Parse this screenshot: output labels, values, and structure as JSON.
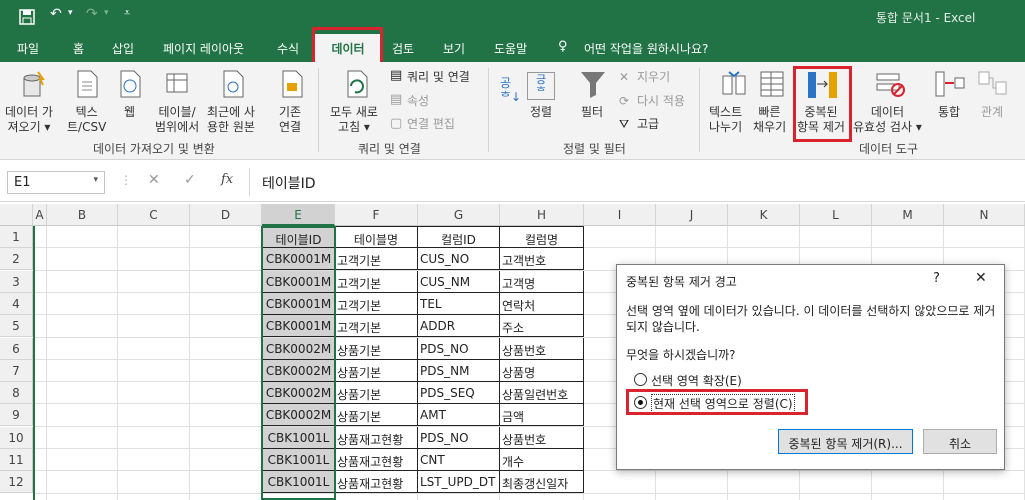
{
  "titlebar": {
    "doc_title": "통합 문서1  -  Excel",
    "save_icon": "save-icon",
    "undo_icon": "undo-icon",
    "redo_icon": "redo-icon"
  },
  "menu": {
    "items": [
      "파일",
      "홈",
      "삽입",
      "페이지 레이아웃",
      "수식",
      "데이터",
      "검토",
      "보기",
      "도움말"
    ],
    "search": "어떤 작업을 원하시나요?"
  },
  "ribbon": {
    "get_data": "데이터 가\n져오기 ▾",
    "text_csv": "텍스\n트/CSV",
    "web": "웹",
    "table_range": "테이블/\n범위에서",
    "recent": "최근에 사\n용한 원본",
    "existing": "기존\n연결",
    "group1": "데이터 가져오기 및 변환",
    "refresh_all": "모두 새로\n고침 ▾",
    "queries": "쿼리 및 연결",
    "properties": "속성",
    "edit_links": "연결 편집",
    "group2": "쿼리 및 연결",
    "sort": "정렬",
    "filter": "필터",
    "clear": "지우기",
    "reapply": "다시 적용",
    "advanced": "고급",
    "group3": "정렬 및 필터",
    "text_to_columns": "텍스트\n나누기",
    "flash_fill": "빠른\n채우기",
    "remove_dup": "중복된\n항목 제거",
    "validation": "데이터\n유효성 검사 ▾",
    "consolidate": "통합",
    "relations": "관계",
    "group4": "데이터 도구"
  },
  "formula": {
    "name_box": "E1",
    "value": "테이블ID",
    "fx": "fx"
  },
  "columns": [
    "A",
    "B",
    "C",
    "D",
    "E",
    "F",
    "G",
    "H",
    "I",
    "J",
    "K",
    "L",
    "M",
    "N"
  ],
  "rows": [
    "1",
    "2",
    "3",
    "4",
    "5",
    "6",
    "7",
    "8",
    "9",
    "10",
    "11",
    "12"
  ],
  "table": [
    [
      "테이블ID",
      "테이블명",
      "컬럼ID",
      "컬럼명"
    ],
    [
      "CBK0001M",
      "고객기본",
      "CUS_NO",
      "고객번호"
    ],
    [
      "CBK0001M",
      "고객기본",
      "CUS_NM",
      "고객명"
    ],
    [
      "CBK0001M",
      "고객기본",
      "TEL",
      "연락처"
    ],
    [
      "CBK0001M",
      "고객기본",
      "ADDR",
      "주소"
    ],
    [
      "CBK0002M",
      "상품기본",
      "PDS_NO",
      "상품번호"
    ],
    [
      "CBK0002M",
      "상품기본",
      "PDS_NM",
      "상품명"
    ],
    [
      "CBK0002M",
      "상품기본",
      "PDS_SEQ",
      "상품일련번호"
    ],
    [
      "CBK0002M",
      "상품기본",
      "AMT",
      "금액"
    ],
    [
      "CBK1001L",
      "상품재고현황",
      "PDS_NO",
      "상품번호"
    ],
    [
      "CBK1001L",
      "상품재고현황",
      "CNT",
      "개수"
    ],
    [
      "CBK1001L",
      "상품재고현황",
      "LST_UPD_DT",
      "최종갱신일자"
    ]
  ],
  "dialog": {
    "title": "중복된 항목 제거 경고",
    "help": "?",
    "close": "✕",
    "message": "선택 영역 옆에 데이터가 있습니다. 이 데이터를 선택하지 않았으므로 제거되지 않습니다.",
    "question": "무엇을 하시겠습니까?",
    "option1": "선택 영역 확장(E)",
    "option2": "현재 선택 영역으로 정렬(C)",
    "ok": "중복된 항목 제거(R)...",
    "cancel": "취소"
  },
  "colors": {
    "excel_green": "#217346",
    "highlight": "#d9232e",
    "selected_col": "#d2d2d2"
  }
}
